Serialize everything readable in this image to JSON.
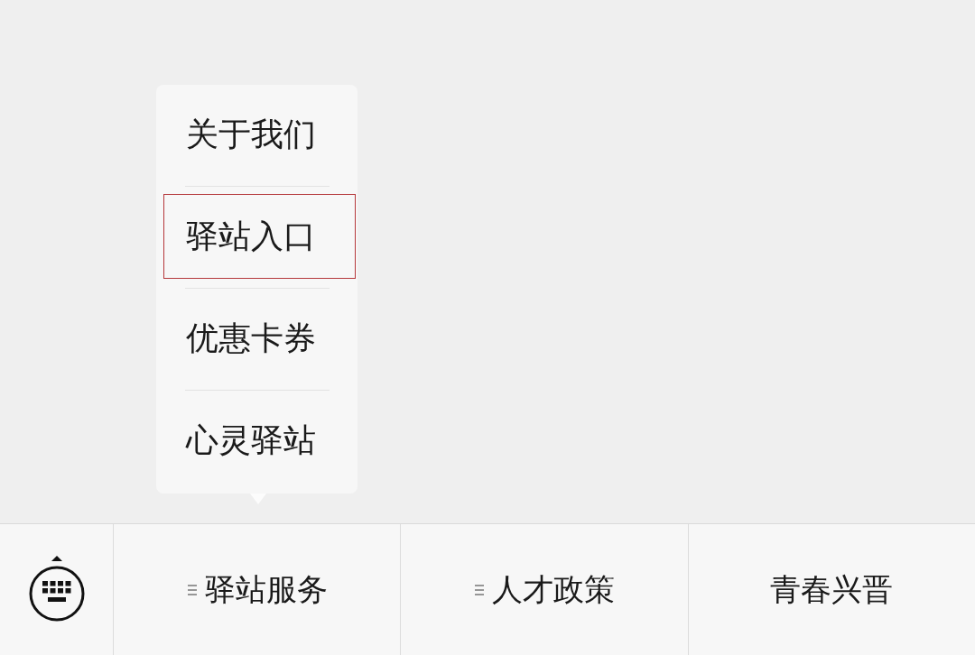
{
  "popup_menu": {
    "items": [
      {
        "label": "关于我们",
        "highlighted": false
      },
      {
        "label": "驿站入口",
        "highlighted": true
      },
      {
        "label": "优惠卡券",
        "highlighted": false
      },
      {
        "label": "心灵驿站",
        "highlighted": false
      }
    ]
  },
  "menu_bar": {
    "items": [
      {
        "label": "驿站服务",
        "has_submenu": true
      },
      {
        "label": "人才政策",
        "has_submenu": true
      },
      {
        "label": "青春兴晋",
        "has_submenu": false
      }
    ]
  }
}
